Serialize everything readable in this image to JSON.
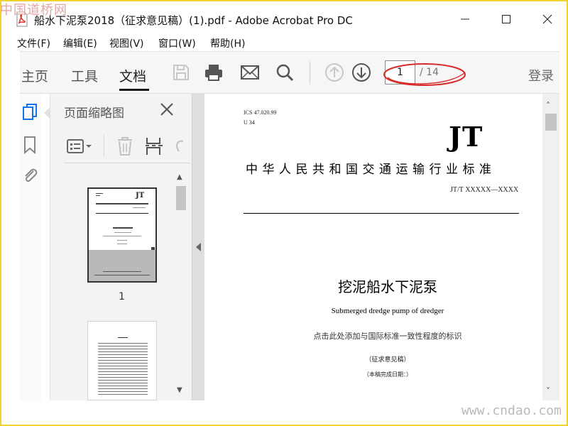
{
  "watermarks": {
    "top_left": "中国道桥网",
    "bottom_right": "www.cndao.com"
  },
  "window": {
    "title": "船水下泥泵2018（征求意见稿）(1).pdf - Adobe Acrobat Pro DC",
    "controls": [
      "minimize-icon",
      "maximize-icon",
      "close-icon"
    ]
  },
  "menubar": {
    "items": [
      "文件(F)",
      "编辑(E)",
      "视图(V)",
      "窗口(W)",
      "帮助(H)"
    ]
  },
  "toolbar": {
    "tabs": [
      "主页",
      "工具",
      "文档"
    ],
    "active_tab": "文档",
    "icons": [
      "save-icon",
      "print-icon",
      "email-icon",
      "search-icon",
      "page-up-icon",
      "page-down-icon"
    ],
    "page_current": "1",
    "page_total": "/ 14",
    "login": "登录",
    "highlight_color": "#d92a2a"
  },
  "left_rail": {
    "icons": [
      "page-thumbnails-icon",
      "bookmark-icon",
      "attachment-icon"
    ],
    "active_color": "#1473e6"
  },
  "thumbnail_panel": {
    "title": "页面缩略图",
    "tools": [
      "options-menu-icon",
      "delete-page-icon",
      "extract-pages-icon",
      "rotate-icon"
    ],
    "pages": [
      {
        "number": "1"
      },
      {
        "number": ""
      }
    ],
    "thumb_jt": "JT"
  },
  "document": {
    "ics": "ICS 47.020.99",
    "u_code": "U 34",
    "logo": "JT",
    "standard_title": "中华人民共和国交通运输行业标准",
    "standard_number": "JT/T XXXXX—XXXX",
    "cn_name": "挖泥船水下泥泵",
    "en_name": "Submerged dredge pump of dredger",
    "note": "点击此处添加与国际标准一致性程度的标识",
    "draft": "（征求意见稿）",
    "date_line": "（本稿完成日期：）"
  }
}
